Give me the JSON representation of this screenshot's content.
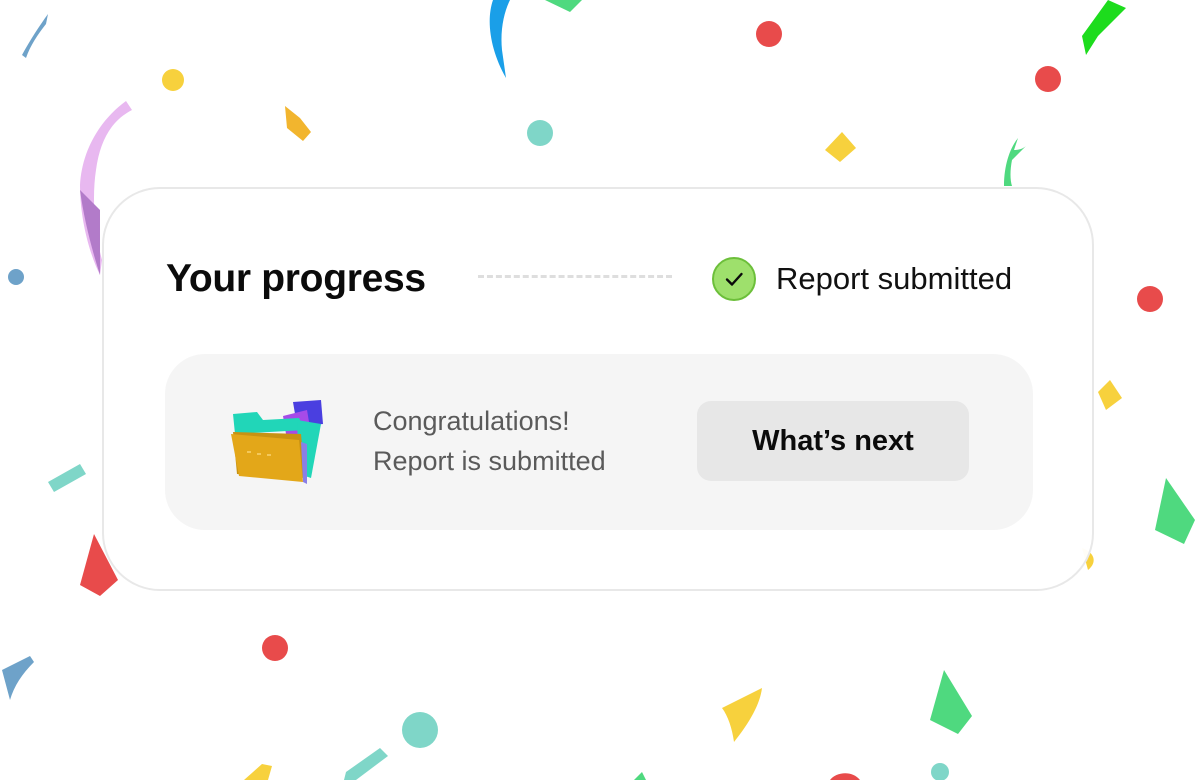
{
  "progress": {
    "title": "Your progress",
    "status_label": "Report submitted",
    "status_icon": "check-icon",
    "status_color": "#9ee06c"
  },
  "panel": {
    "icon": "folder-icon",
    "message_line1": "Congratulations!",
    "message_line2": "Report is submitted",
    "next_button_label": "What’s next"
  },
  "decoration": {
    "confetti_colors": [
      "#e84b4b",
      "#f7d13d",
      "#7fd6c8",
      "#4fd97f",
      "#1a9fe8",
      "#6ea2c9",
      "#e8b8f0",
      "#b27bc9",
      "#1ddc1d"
    ]
  }
}
